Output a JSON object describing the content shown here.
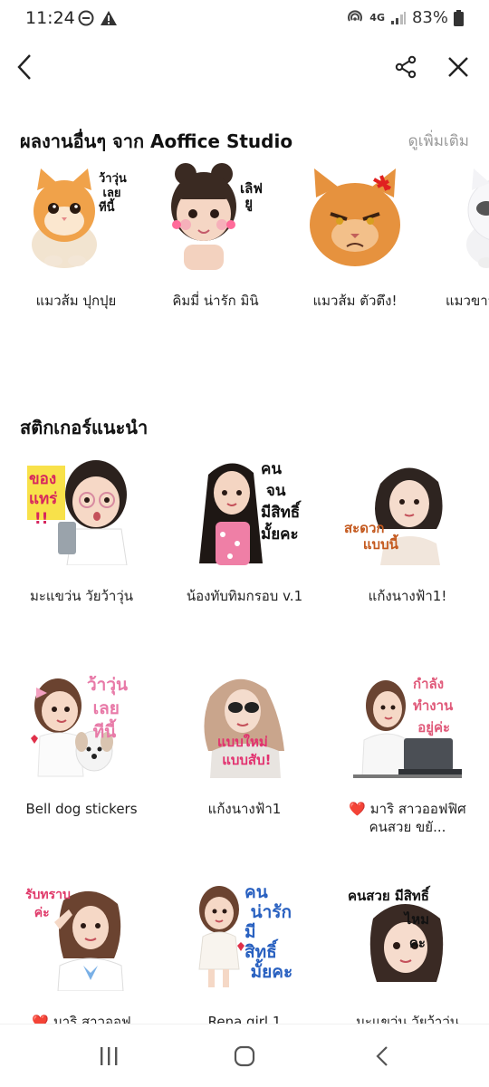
{
  "status": {
    "time": "11:24",
    "network": "4G",
    "battery": "83%"
  },
  "topbar": {
    "back_icon": "chevron-left-icon",
    "share_icon": "share-icon",
    "close_icon": "close-icon"
  },
  "other_works": {
    "title": "ผลงานอื่นๆ จาก Aoffice Studio",
    "see_more": "ดูเพิ่มเติม",
    "items": [
      {
        "label": "แมวส้ม ปุกปุย",
        "caption": "ว้าวุ่น\nเลย\nทีนี้"
      },
      {
        "label": "คิมมี่ น่ารัก มินิ",
        "caption": "เลิฟ\nยู"
      },
      {
        "label": "แมวส้ม ตัวตึง!",
        "caption": ""
      },
      {
        "label": "แมวขาว (",
        "caption": ""
      }
    ]
  },
  "recommended": {
    "title": "สติกเกอร์แนะนำ",
    "items": [
      {
        "label": "มะแขว่น วัยว้าวุ่น",
        "caption": "ของ\nแทร่\n!!"
      },
      {
        "label": "น้องทับทิมกรอบ v.1",
        "caption": "คน\nจน\nมีสิทธิ์\nมั้ยคะ"
      },
      {
        "label": "แก้งนางฟ้า1!",
        "caption": "สะดวก\nแบบนี้"
      },
      {
        "label": "Bell dog stickers",
        "caption": "ว้าวุ่น\nเลย\nทีนี้"
      },
      {
        "label": "แก้งนางฟ้า1",
        "caption": "แบบใหม่\nแบบสับ!"
      },
      {
        "label": "❤️ มาริ สาวออฟฟิศคนสวย ขยั...",
        "caption": "กำลัง\nทำงาน\nอยู่ค่ะ"
      },
      {
        "label": "❤️ มาริ สาวออฟ",
        "caption": "รับทราบ\nค่ะ"
      },
      {
        "label": "Rena girl 1",
        "caption": "คน\nน่ารัก\nมี\nสิทธิ์\nมั้ยคะ"
      },
      {
        "label": "มะแขว่น วัยว้าวุ่น",
        "caption": "คนสวย มีสิทธิ์\nไหม\nคะ"
      }
    ]
  },
  "colors": {
    "orange_cat": "#f0a24a",
    "skin": "#f3d2bf",
    "dark_hair": "#2b211d",
    "brown_hair": "#6b4330",
    "pink": "#e8447a",
    "gray_text": "#9a9a9a"
  }
}
